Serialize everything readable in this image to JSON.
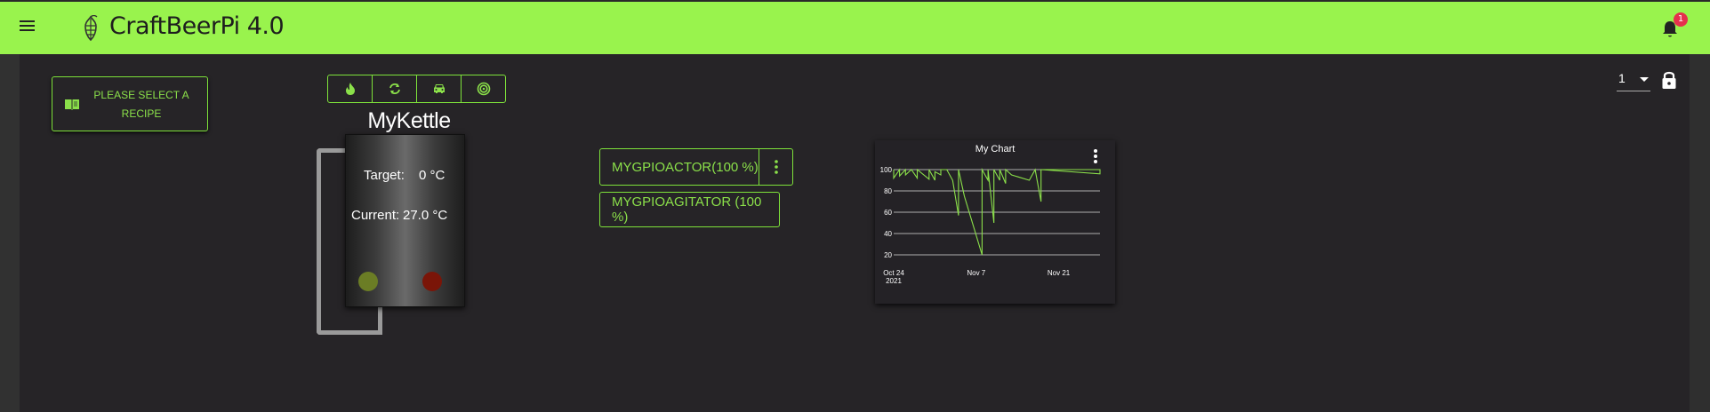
{
  "app": {
    "title": "CraftBeerPi 4.0",
    "notification_count": "1"
  },
  "recipe": {
    "label_line1": "PLEASE SELECT A",
    "label_line2": "RECIPE"
  },
  "kettle": {
    "name": "MyKettle",
    "target_label": "Target:",
    "target_value": "0 °C",
    "current_label": "Current:",
    "current_value": "27.0 °C",
    "toolbar_icons": [
      "flame-icon",
      "sync-icon",
      "car-icon",
      "target-icon"
    ]
  },
  "actors": [
    {
      "label": "MYGPIOACTOR(100 %)"
    },
    {
      "label": "MYGPIOAGITATOR (100 %)"
    }
  ],
  "dashboard": {
    "page": "1"
  },
  "colors": {
    "accent": "#99f34d",
    "accent_text": "#8be04a",
    "background": "#262427",
    "led_on": "#6b7d25",
    "led_off": "#7a1508",
    "badge": "#e5304d"
  },
  "chart_data": {
    "type": "line",
    "title": "My Chart",
    "xlabel": "",
    "ylabel": "",
    "yticks": [
      20,
      40,
      60,
      80,
      100
    ],
    "xticks": [
      {
        "label": "Oct 24",
        "sub": "2021",
        "x": "2021-10-24"
      },
      {
        "label": "Nov 7",
        "sub": "",
        "x": "2021-11-07"
      },
      {
        "label": "Nov 21",
        "sub": "",
        "x": "2021-11-21"
      }
    ],
    "xlim": [
      "2021-10-24",
      "2021-11-28"
    ],
    "ylim": [
      10,
      100
    ],
    "grid": true,
    "color": "#8be04a",
    "series": [
      {
        "values": [
          {
            "x": "2021-10-24",
            "y": 100
          },
          {
            "x": "2021-10-24",
            "y": 92
          },
          {
            "x": "2021-10-25",
            "y": 100
          },
          {
            "x": "2021-10-25",
            "y": 94
          },
          {
            "x": "2021-10-26",
            "y": 100
          },
          {
            "x": "2021-10-26",
            "y": 95
          },
          {
            "x": "2021-10-27",
            "y": 100
          },
          {
            "x": "2021-10-28",
            "y": 92
          },
          {
            "x": "2021-10-28",
            "y": 100
          },
          {
            "x": "2021-10-30",
            "y": 91
          },
          {
            "x": "2021-10-30",
            "y": 100
          },
          {
            "x": "2021-10-31",
            "y": 90
          },
          {
            "x": "2021-10-31",
            "y": 98
          },
          {
            "x": "2021-11-01",
            "y": 95
          },
          {
            "x": "2021-11-01",
            "y": 100
          },
          {
            "x": "2021-11-02",
            "y": 100
          },
          {
            "x": "2021-11-03",
            "y": 90
          },
          {
            "x": "2021-11-04",
            "y": 57
          },
          {
            "x": "2021-11-04",
            "y": 100
          },
          {
            "x": "2021-11-05",
            "y": 75
          },
          {
            "x": "2021-11-08",
            "y": 20
          },
          {
            "x": "2021-11-08",
            "y": 100
          },
          {
            "x": "2021-11-09",
            "y": 90
          },
          {
            "x": "2021-11-09",
            "y": 100
          },
          {
            "x": "2021-11-10",
            "y": 50
          },
          {
            "x": "2021-11-10",
            "y": 100
          },
          {
            "x": "2021-11-11",
            "y": 90
          },
          {
            "x": "2021-11-11",
            "y": 100
          },
          {
            "x": "2021-11-12",
            "y": 87
          },
          {
            "x": "2021-11-12",
            "y": 100
          },
          {
            "x": "2021-11-13",
            "y": 95
          },
          {
            "x": "2021-11-16",
            "y": 90
          },
          {
            "x": "2021-11-17",
            "y": 100
          },
          {
            "x": "2021-11-18",
            "y": 70
          },
          {
            "x": "2021-11-18",
            "y": 100
          },
          {
            "x": "2021-11-28",
            "y": 100
          },
          {
            "x": "2021-11-28",
            "y": 96
          },
          {
            "x": "2021-11-18",
            "y": 100
          }
        ]
      }
    ]
  }
}
